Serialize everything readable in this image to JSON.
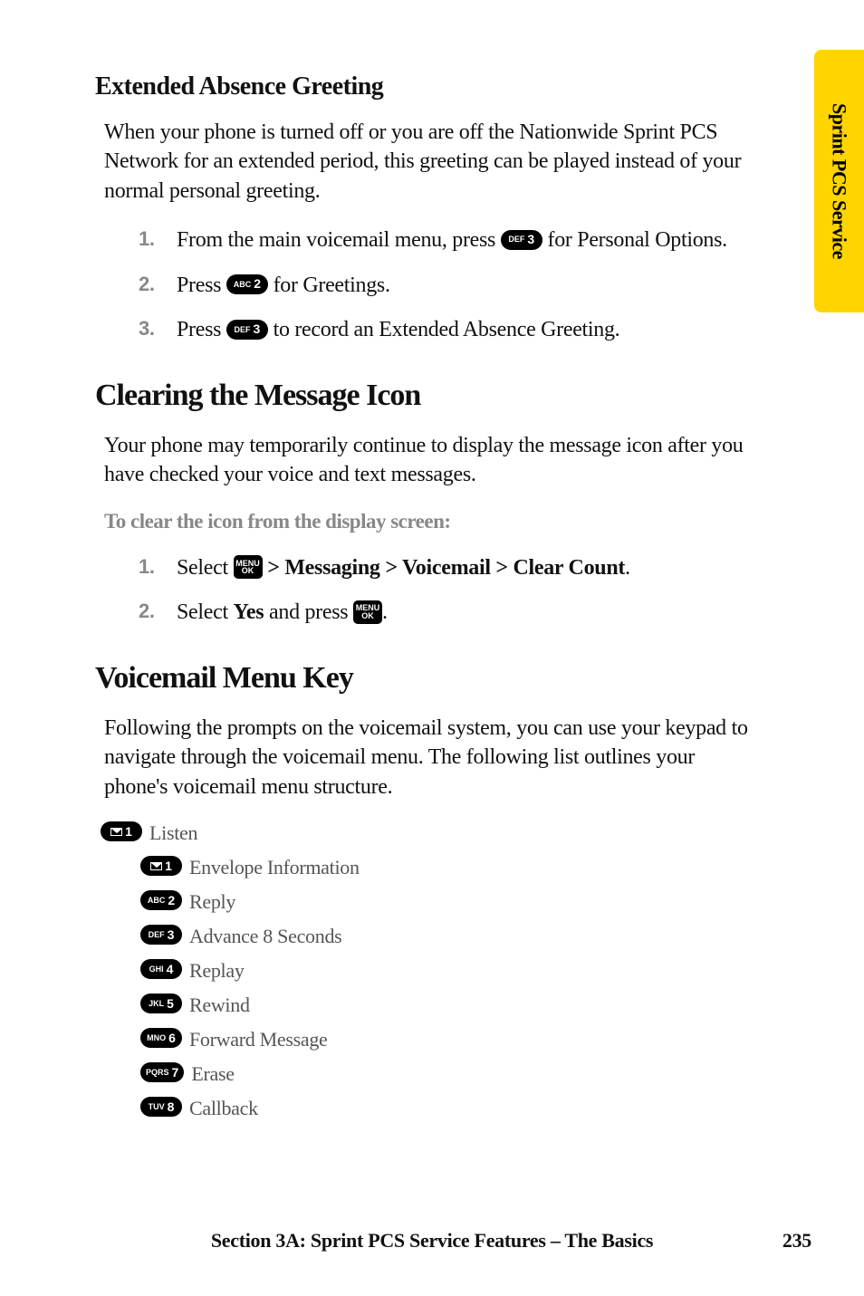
{
  "sideTab": "Sprint PCS Service",
  "sections": {
    "extAbsence": {
      "title": "Extended Absence Greeting",
      "intro": "When your phone is turned off or you are off the Nationwide Sprint PCS Network for an extended period, this greeting can be played instead of your normal personal greeting.",
      "steps": {
        "s1a": "From the main voicemail menu, press ",
        "s1b": " for Personal Options.",
        "s2a": "Press ",
        "s2b": " for Greetings.",
        "s3a": "Press ",
        "s3b": " to record an Extended Absence Greeting."
      }
    },
    "clearing": {
      "title": "Clearing the Message Icon",
      "intro": "Your phone may temporarily continue to display the message icon after you have checked your voice and text messages.",
      "subhead": "To clear the icon from the display screen:",
      "steps": {
        "s1a": "Select ",
        "s1b": " > Messaging > Voicemail > Clear Count",
        "s1c": ".",
        "s2a": "Select ",
        "s2b": "Yes",
        "s2c": " and press ",
        "s2d": "."
      }
    },
    "vmKey": {
      "title": "Voicemail Menu Key",
      "intro": "Following the prompts on the voicemail system, you can use your keypad to navigate through the voicemail menu. The following list outlines your phone's voicemail menu structure.",
      "tree": {
        "listen": "Listen",
        "envInfo": "Envelope Information",
        "reply": "Reply",
        "advance": "Advance 8 Seconds",
        "replay": "Replay",
        "rewind": "Rewind",
        "forward": "Forward Message",
        "erase": "Erase",
        "callback": "Callback"
      }
    }
  },
  "keys": {
    "mail1_sm": "",
    "mail1_big": "1",
    "abc2_sm": "ABC",
    "abc2_big": "2",
    "def3_sm": "DEF",
    "def3_big": "3",
    "ghi4_sm": "GHI",
    "ghi4_big": "4",
    "jkl5_sm": "JKL",
    "jkl5_big": "5",
    "mno6_sm": "MNO",
    "mno6_big": "6",
    "pqrs7_sm": "PQRS",
    "pqrs7_big": "7",
    "tuv8_sm": "TUV",
    "tuv8_big": "8",
    "menu_top": "MENU",
    "menu_bot": "OK"
  },
  "footer": {
    "text": "Section 3A: Sprint PCS Service Features – The Basics",
    "page": "235"
  }
}
